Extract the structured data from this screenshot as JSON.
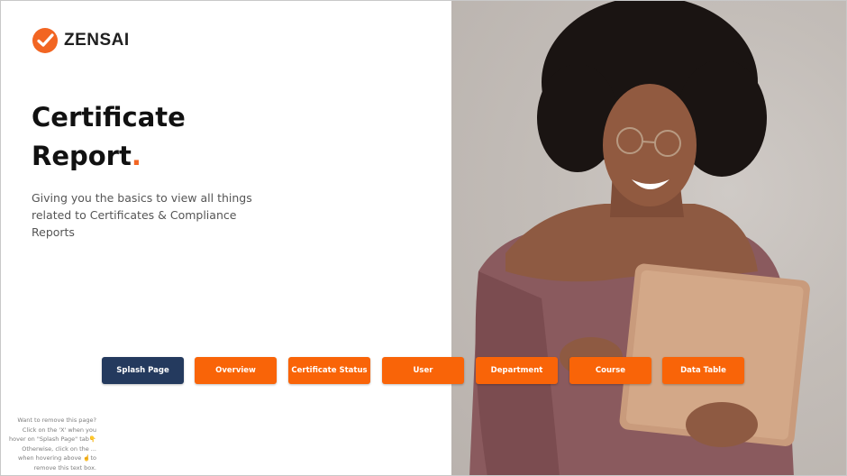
{
  "brand": {
    "name": "ZENSAI",
    "accent": "#f26522"
  },
  "hero": {
    "title_line1": "Certificate",
    "title_line2": "Report",
    "title_dot": ".",
    "subtitle": "Giving you the basics to view all things related to Certificates & Compliance Reports"
  },
  "nav": [
    {
      "label": "Splash Page",
      "active": true
    },
    {
      "label": "Overview",
      "active": false
    },
    {
      "label": "Certificate Status",
      "active": false
    },
    {
      "label": "User",
      "active": false
    },
    {
      "label": "Department",
      "active": false
    },
    {
      "label": "Course",
      "active": false
    },
    {
      "label": "Data Table",
      "active": false
    }
  ],
  "help_note": "Want to remove this page? Click on the 'X' when you hover on \"Splash Page\" tab👇 Otherwise, click on the ... when hovering above ☝️to remove this text box.",
  "colors": {
    "button": "#f96408",
    "button_active": "#243a5e"
  },
  "photo_icon": "woman-with-tablet-photo"
}
